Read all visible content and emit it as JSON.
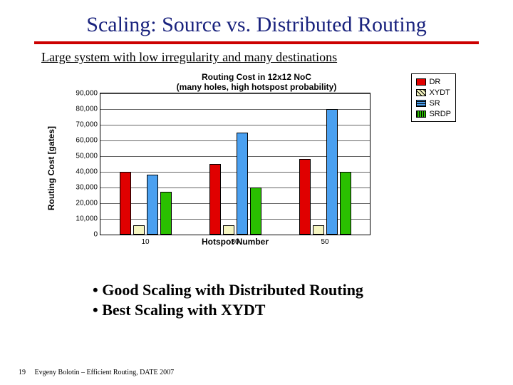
{
  "title": "Scaling: Source vs. Distributed Routing",
  "subhead": "Large system with low irregularity and many destinations",
  "chart_data": {
    "type": "bar",
    "title_line1": "Routing Cost in 12x12 NoC",
    "title_line2": "(many holes, high hotspost probability)",
    "xlabel": "Hotspot Number",
    "ylabel": "Routing Cost [gates]",
    "ylim": [
      0,
      90000
    ],
    "y_ticks": [
      "0",
      "10,000",
      "20,000",
      "30,000",
      "40,000",
      "50,000",
      "60,000",
      "70,000",
      "80,000",
      "90,000"
    ],
    "categories": [
      "10",
      "30",
      "50"
    ],
    "series": [
      {
        "name": "DR",
        "values": [
          40000,
          45000,
          48000
        ],
        "color": "#e00000",
        "pattern": "solid"
      },
      {
        "name": "XYDT",
        "values": [
          6000,
          6000,
          6000
        ],
        "color": "#f5f5c0",
        "pattern": "diag"
      },
      {
        "name": "SR",
        "values": [
          38000,
          65000,
          80000
        ],
        "color": "#4aa0f0",
        "pattern": "horiz"
      },
      {
        "name": "SRDP",
        "values": [
          27000,
          30000,
          40000
        ],
        "color": "#2ac000",
        "pattern": "vert"
      }
    ],
    "legend_position": "outside-right-top",
    "grid": true
  },
  "legend": {
    "dr": "DR",
    "xydt": "XYDT",
    "sr": "SR",
    "srdp": "SRDP"
  },
  "bullets": {
    "b1": "• Good Scaling with Distributed Routing",
    "b2": "• Best Scaling with XYDT"
  },
  "footer": {
    "page": "19",
    "text": "Evgeny Bolotin – Efficient Routing, DATE 2007"
  }
}
